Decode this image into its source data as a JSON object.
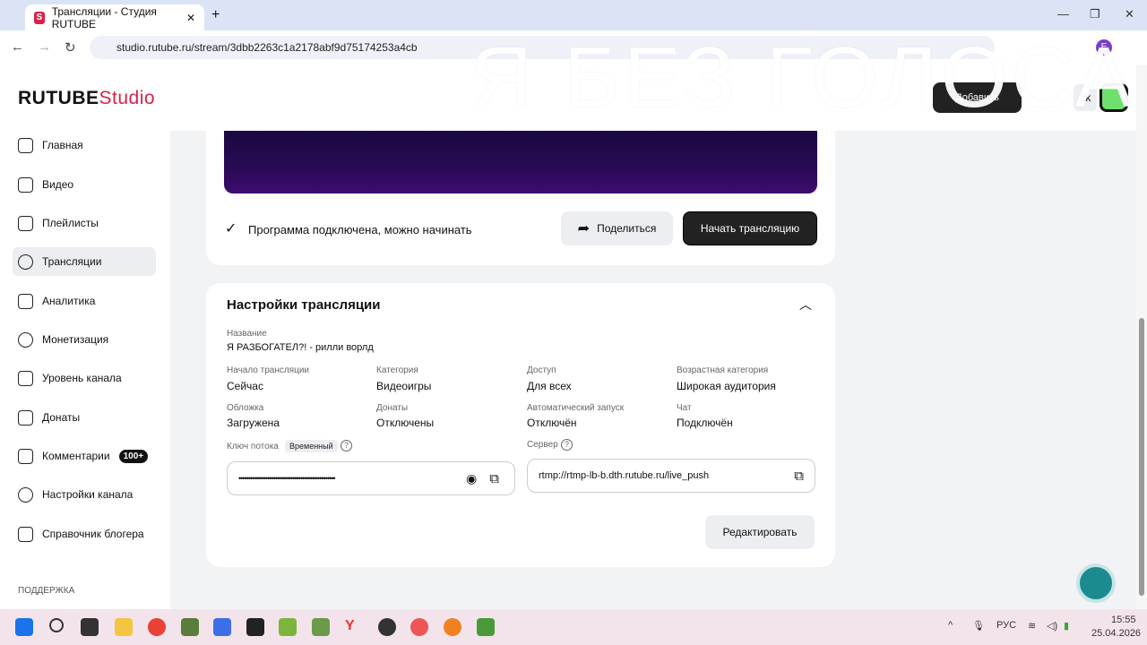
{
  "browser": {
    "tab_title": "Трансляции - Студия RUTUBE",
    "url": "studio.rutube.ru/stream/3dbb2263c1a2178abf9d75174253a4cb",
    "profile_initial": "E"
  },
  "overlay_text": "Я БЕЗ ГОЛОСА",
  "header": {
    "logo_main": "RUTUBE",
    "logo_studio": "Studio",
    "add_button": "Добавить",
    "counter": "2k"
  },
  "sidebar": {
    "items": [
      {
        "label": "Главная",
        "icon": "home-icon"
      },
      {
        "label": "Видео",
        "icon": "video-icon"
      },
      {
        "label": "Плейлисты",
        "icon": "playlist-icon"
      },
      {
        "label": "Трансляции",
        "icon": "broadcast-icon"
      },
      {
        "label": "Аналитика",
        "icon": "analytics-icon"
      },
      {
        "label": "Монетизация",
        "icon": "money-icon"
      },
      {
        "label": "Уровень канала",
        "icon": "level-icon"
      },
      {
        "label": "Донаты",
        "icon": "donate-icon"
      },
      {
        "label": "Комментарии",
        "icon": "comment-icon",
        "badge": "100+"
      },
      {
        "label": "Настройки канала",
        "icon": "gear-icon"
      },
      {
        "label": "Справочник блогера",
        "icon": "book-icon"
      }
    ],
    "support": "ПОДДЕРЖКА"
  },
  "status": {
    "text": "Программа подключена, можно начинать",
    "share": "Поделиться",
    "start": "Начать трансляцию"
  },
  "settings": {
    "title": "Настройки трансляции",
    "name_label": "Название",
    "name_value": "Я РАЗБОГАТЕЛ?! - рилли ворлд",
    "fields": [
      {
        "label": "Начало трансляции",
        "value": "Сейчас"
      },
      {
        "label": "Категория",
        "value": "Видеоигры"
      },
      {
        "label": "Доступ",
        "value": "Для всех"
      },
      {
        "label": "Возрастная категория",
        "value": "Широкая аудитория"
      },
      {
        "label": "Обложка",
        "value": "Загружена"
      },
      {
        "label": "Донаты",
        "value": "Отключены"
      },
      {
        "label": "Автоматический запуск",
        "value": "Отключён"
      },
      {
        "label": "Чат",
        "value": "Подключён"
      }
    ],
    "key_label": "Ключ потока",
    "key_tag": "Временный",
    "key_value": "••••••••••••••••••••••••••••••••••••••••••••••••••",
    "server_label": "Сервер",
    "server_value": "rtmp://rtmp-lb-b.dth.rutube.ru/live_push",
    "edit": "Редактировать"
  },
  "tray": {
    "lang": "РУС",
    "time": "15:55",
    "date": "25.04.2026"
  }
}
